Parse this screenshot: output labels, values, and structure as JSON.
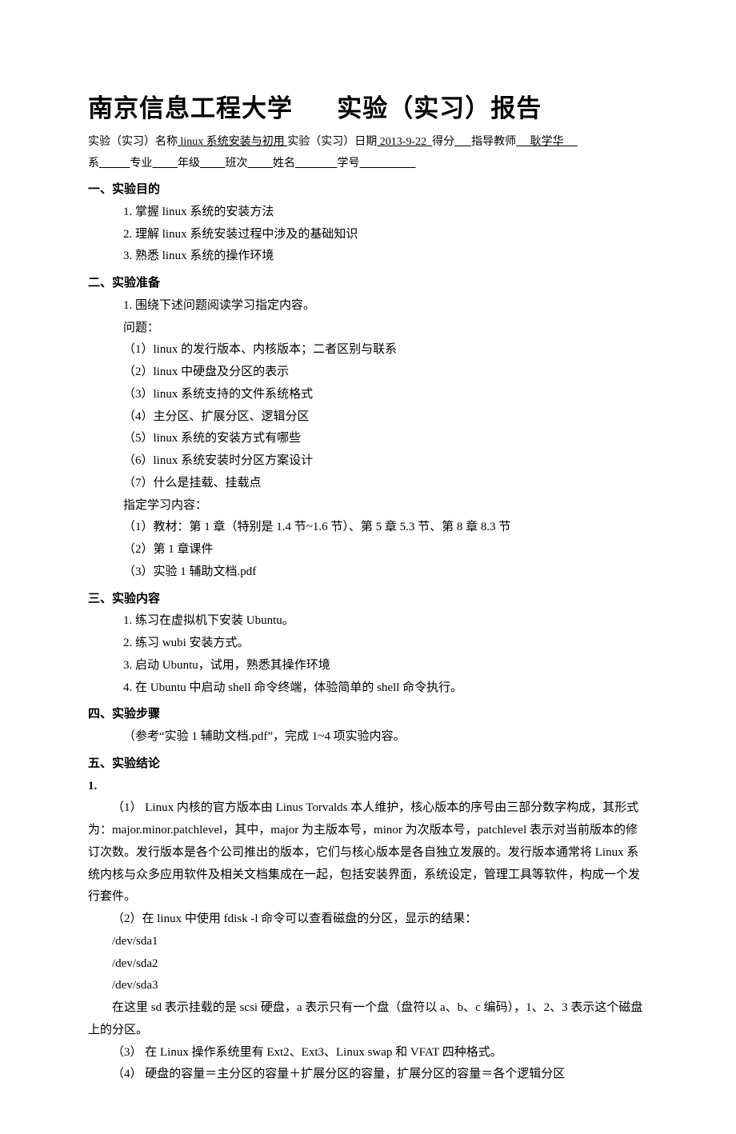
{
  "title": {
    "seg1": "南京信息工程大学",
    "seg2": "实验（实习）报告"
  },
  "meta1": {
    "prefix": "实验（实习）名称",
    "name": " linux 系统安装与初用 ",
    "dateLabel": "实验（实习）日期",
    "date": " 2013-9-22  ",
    "scoreLabel": "得分",
    "scoreBlank": "      ",
    "teacherLabel": "指导教师",
    "teacher": "     耿学华     "
  },
  "meta2": {
    "deptLabel": "系",
    "b1": "           ",
    "majorLabel": "专业",
    "b2": "         ",
    "gradeLabel": "年级",
    "b3": "         ",
    "classLabel": "班次",
    "b4": "         ",
    "nameLabel": "姓名",
    "b5": "               ",
    "idLabel": "学号",
    "b6": "                    "
  },
  "sec1": {
    "head": "一、实验目的",
    "items": [
      "1.  掌握 linux 系统的安装方法",
      "2.  理解 linux 系统安装过程中涉及的基础知识",
      "3.  熟悉 linux 系统的操作环境"
    ]
  },
  "sec2": {
    "head": "二、实验准备",
    "items": [
      "1.  围绕下述问题阅读学习指定内容。",
      "问题：",
      "（1）linux 的发行版本、内核版本；二者区别与联系",
      "（2）linux 中硬盘及分区的表示",
      "（3）linux 系统支持的文件系统格式",
      "（4）主分区、扩展分区、逻辑分区",
      "（5）linux 系统的安装方式有哪些",
      "（6）linux 系统安装时分区方案设计",
      "（7）什么是挂载、挂载点",
      "指定学习内容：",
      "（1）教材：第 1 章（特别是 1.4 节~1.6 节）、第 5 章  5.3 节、第 8 章  8.3 节",
      "（2）第 1 章课件",
      "（3）实验 1 辅助文档.pdf"
    ]
  },
  "sec3": {
    "head": "三、实验内容",
    "items": [
      "1.  练习在虚拟机下安装 Ubuntu。",
      "2.  练习 wubi 安装方式。",
      "3.  启动 Ubuntu，试用，熟悉其操作环境",
      "4.  在 Ubuntu 中启动 shell 命令终端，体验简单的 shell 命令执行。"
    ]
  },
  "sec4": {
    "head": "四、实验步骤",
    "items": [
      "（参考“实验 1 辅助文档.pdf”，完成 1~4 项实验内容。"
    ]
  },
  "sec5": {
    "head": "五、实验结论",
    "lead": "1.",
    "p1": "（1）  Linux 内核的官方版本由 Linus Torvalds 本人维护，核心版本的序号由三部分数字构成，其形式为：major.minor.patchlevel，其中，major 为主版本号，minor 为次版本号，patchlevel 表示对当前版本的修订次数。发行版本是各个公司推出的版本，它们与核心版本是各自独立发展的。发行版本通常将 Linux 系统内核与众多应用软件及相关文档集成在一起，包括安装界面，系统设定，管理工具等软件，构成一个发行套件。",
    "p2": "（2）在 linux 中使用 fdisk -l  命令可以查看磁盘的分区，显示的结果：",
    "dev1": "/dev/sda1",
    "dev2": "/dev/sda2",
    "dev3": "/dev/sda3",
    "p3": "在这里 sd 表示挂载的是 scsi 硬盘，a 表示只有一个盘（盘符以 a、b、c 编码），1、2、3 表示这个磁盘上的分区。",
    "p4": "（3）  在 Linux 操作系统里有 Ext2、Ext3、Linux swap 和 VFAT 四种格式。",
    "p5": "（4）  硬盘的容量＝主分区的容量＋扩展分区的容量，扩展分区的容量＝各个逻辑分区"
  }
}
